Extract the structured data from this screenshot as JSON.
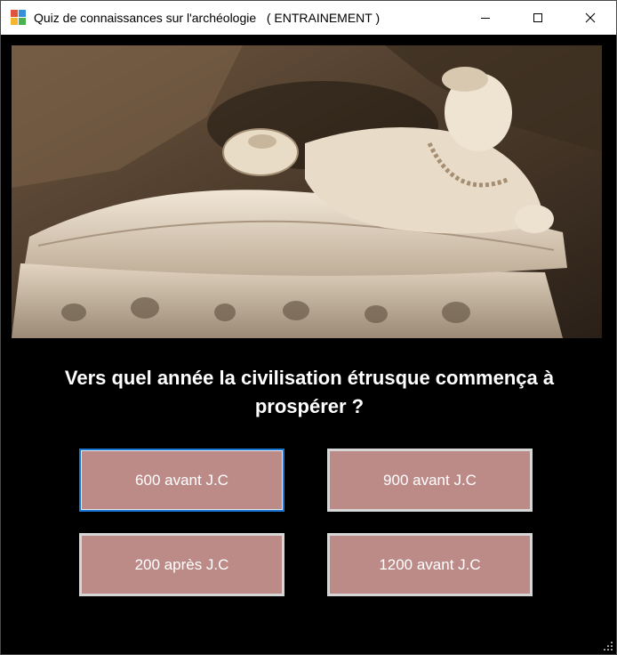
{
  "window": {
    "title": "Quiz de connaissances sur l'archéologie   ( ENTRAINEMENT )",
    "controls": {
      "minimize": "minimize-icon",
      "maximize": "maximize-icon",
      "close": "close-icon"
    }
  },
  "image": {
    "subject": "etruscan-sarcophagus-icon"
  },
  "question": {
    "text": "Vers quel année la civilisation étrusque commença à prospérer ?"
  },
  "answers": [
    {
      "label": "600 avant J.C"
    },
    {
      "label": "900 avant J.C"
    },
    {
      "label": "200 après J.C"
    },
    {
      "label": "1200 avant J.C"
    }
  ],
  "colors": {
    "answer_bg": "#bc8b88",
    "answer_border": "#d6d6d6",
    "focus_border": "#1a78d4",
    "window_bg": "#000000"
  }
}
